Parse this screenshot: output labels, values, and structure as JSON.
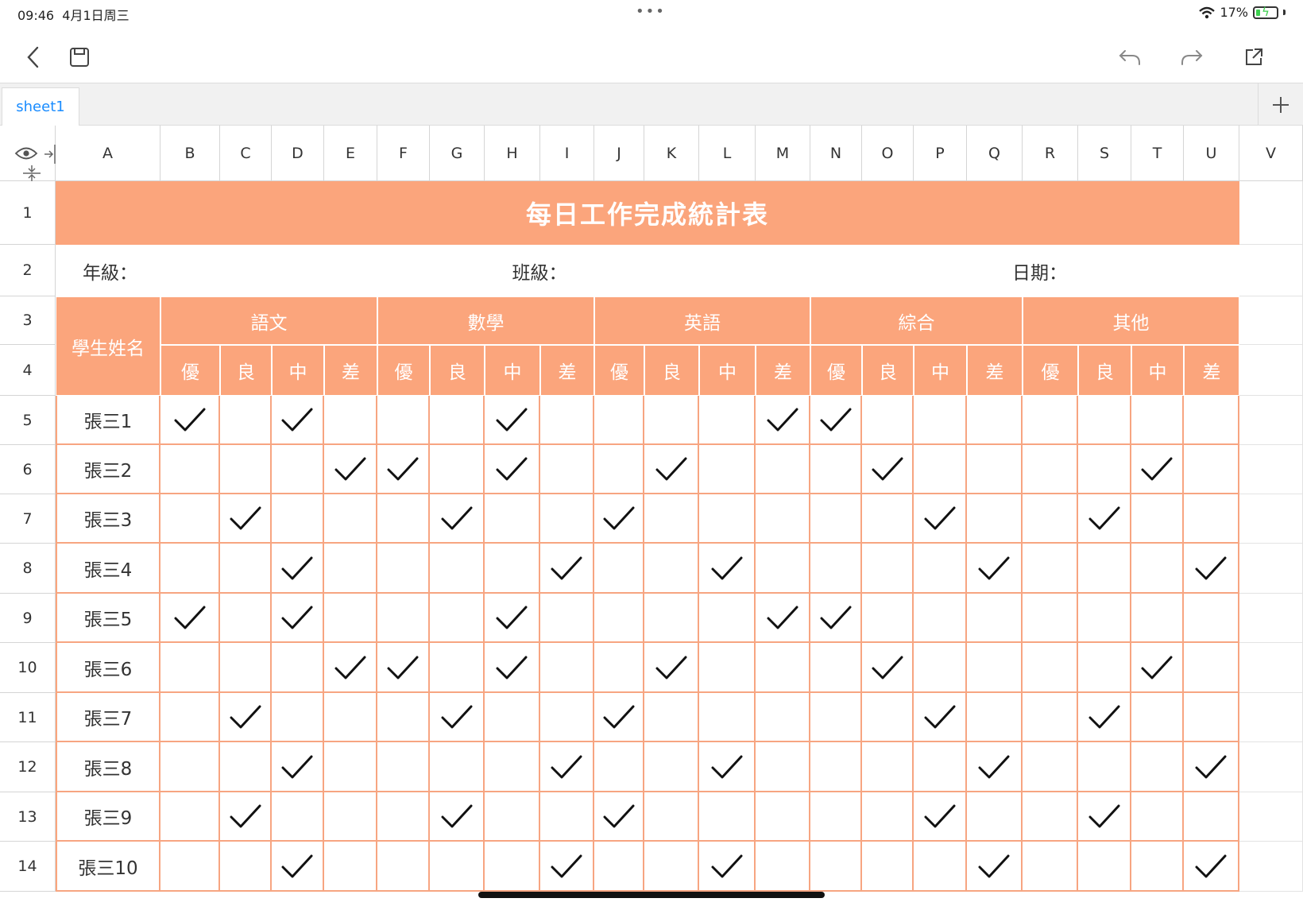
{
  "status": {
    "time": "09:46",
    "date": "4月1日周三",
    "battery": "17%"
  },
  "toolbar": {
    "back_icon": "chevron-left-icon",
    "save_icon": "save-icon",
    "undo_icon": "undo-icon",
    "redo_icon": "redo-icon",
    "share_icon": "share-icon"
  },
  "tabs": [
    {
      "label": "sheet1"
    }
  ],
  "columns": [
    "A",
    "B",
    "C",
    "D",
    "E",
    "F",
    "G",
    "H",
    "I",
    "J",
    "K",
    "L",
    "M",
    "N",
    "O",
    "P",
    "Q",
    "R",
    "S",
    "T",
    "U",
    "V"
  ],
  "rows": [
    "1",
    "2",
    "3",
    "4",
    "5",
    "6",
    "7",
    "8",
    "9",
    "10",
    "11",
    "12",
    "13",
    "14"
  ],
  "sheet": {
    "title": "每日工作完成統計表",
    "grade_label": "年級：",
    "class_label": "班級：",
    "date_label": "日期：",
    "name_header": "學生姓名",
    "subjects": [
      "語文",
      "數學",
      "英語",
      "綜合",
      "其他"
    ],
    "grades": [
      "優",
      "良",
      "中",
      "差"
    ],
    "students": [
      {
        "name": "張三1",
        "checks": [
          0,
          2,
          6,
          11,
          12
        ]
      },
      {
        "name": "張三2",
        "checks": [
          3,
          4,
          6,
          9,
          13,
          18
        ]
      },
      {
        "name": "張三3",
        "checks": [
          1,
          5,
          8,
          14,
          17
        ]
      },
      {
        "name": "張三4",
        "checks": [
          2,
          7,
          10,
          15,
          19
        ]
      },
      {
        "name": "張三5",
        "checks": [
          0,
          2,
          6,
          11,
          12
        ]
      },
      {
        "name": "張三6",
        "checks": [
          3,
          4,
          6,
          9,
          13,
          18
        ]
      },
      {
        "name": "張三7",
        "checks": [
          1,
          5,
          8,
          14,
          17
        ]
      },
      {
        "name": "張三8",
        "checks": [
          2,
          7,
          10,
          15,
          19
        ]
      },
      {
        "name": "張三9",
        "checks": [
          1,
          5,
          8,
          14,
          17
        ]
      },
      {
        "name": "張三10",
        "checks": [
          2,
          7,
          10,
          15,
          19
        ]
      }
    ]
  },
  "colors": {
    "accent": "#fba57c",
    "grid_line": "#f7a581",
    "tab_text": "#1a8cff"
  }
}
